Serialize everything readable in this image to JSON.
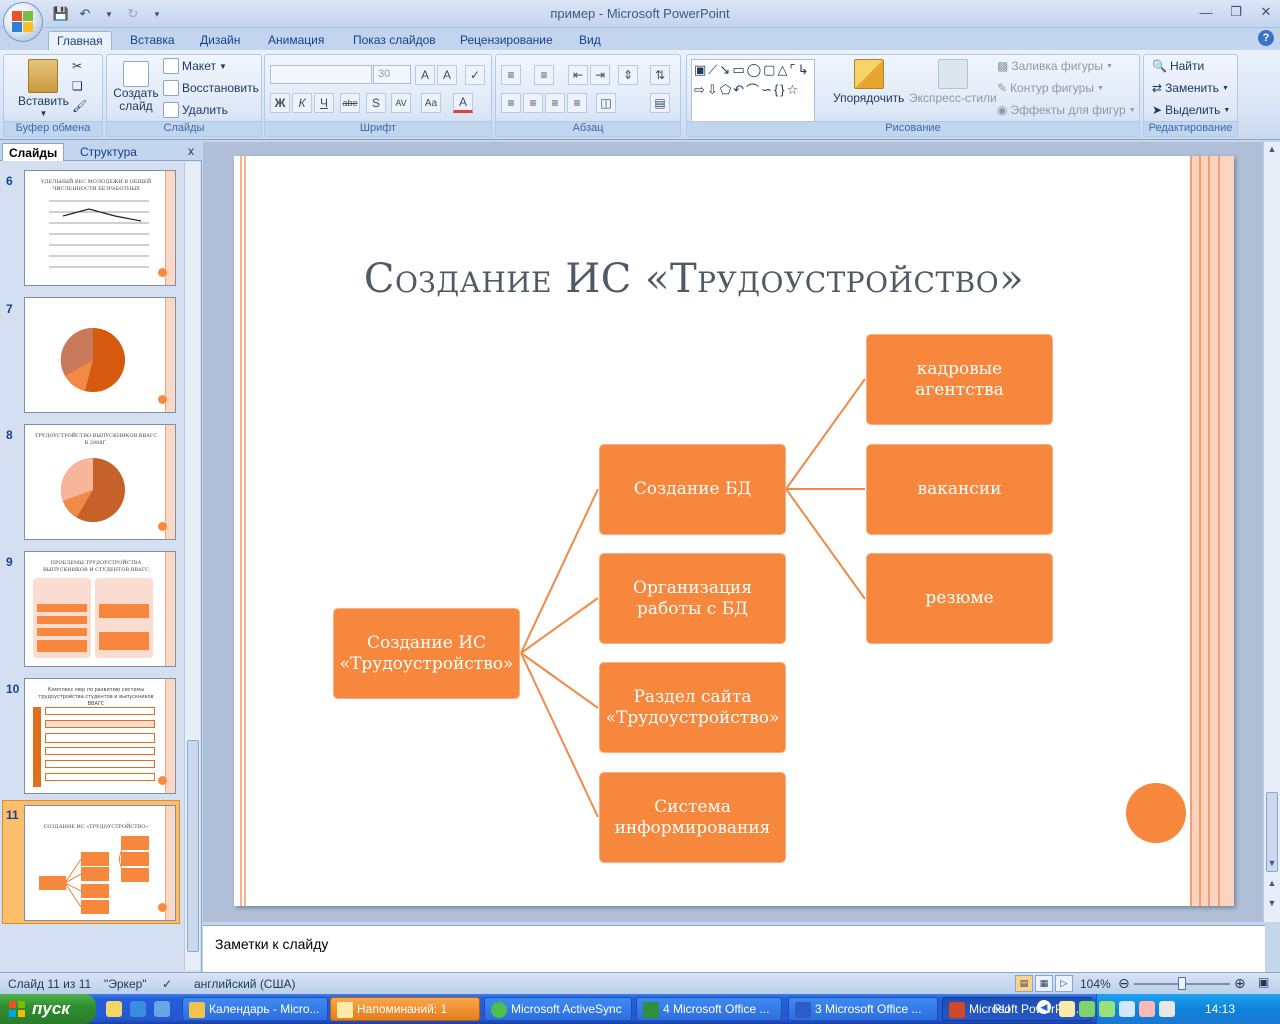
{
  "window": {
    "title": "пример - Microsoft PowerPoint"
  },
  "ribbon": {
    "tabs": [
      "Главная",
      "Вставка",
      "Дизайн",
      "Анимация",
      "Показ слайдов",
      "Рецензирование",
      "Вид"
    ],
    "groups": {
      "clipboard": {
        "label": "Буфер обмена",
        "paste": "Вставить"
      },
      "slides": {
        "label": "Слайды",
        "new_slide": "Создать слайд",
        "layout": "Макет",
        "reset": "Восстановить",
        "delete": "Удалить"
      },
      "font": {
        "label": "Шрифт",
        "font_size": "30"
      },
      "paragraph": {
        "label": "Абзац"
      },
      "drawing": {
        "label": "Рисование",
        "arrange": "Упорядочить",
        "quick_styles": "Экспресс-стили",
        "fill": "Заливка фигуры",
        "outline": "Контур фигуры",
        "effects": "Эффекты для фигур"
      },
      "editing": {
        "label": "Редактирование",
        "find": "Найти",
        "replace": "Заменить",
        "select": "Выделить"
      }
    }
  },
  "slide_pane": {
    "tabs": [
      "Слайды",
      "Структура"
    ],
    "close": "x",
    "thumbnails": [
      {
        "num": "6",
        "title": "УДЕЛЬНЫЙ ВЕС МОЛОДЕЖИ В ОБЩЕЙ ЧИСЛЕННОСТИ БЕЗРАБОТНЫХ"
      },
      {
        "num": "7",
        "title": ""
      },
      {
        "num": "8",
        "title": "ТРУДОУСТРОЙСТВО ВЫПУСКНИКОВ ВВАГС В 2008Г."
      },
      {
        "num": "9",
        "title": "ПРОБЛЕМЫ ТРУДОУСТРОЙСТВА ВЫПУСКНИКОВ И СТУДЕНТОВ ВВАГС"
      },
      {
        "num": "10",
        "title": "Комплекс мер по развитию системы трудоустройства студентов и выпускников ВВАГС"
      },
      {
        "num": "11",
        "title": "СОЗДАНИЕ ИС «ТРУДОУСТРОЙСТВО»"
      }
    ]
  },
  "slide": {
    "title": "Создание ИС «Трудоустройство»",
    "nodes": {
      "root": "Создание ИС «Трудоустройство»",
      "db": "Создание БД",
      "org": "Организация работы с БД",
      "site": "Раздел сайта «Трудоустройство»",
      "info": "Система информирования",
      "agencies": "кадровые агентства",
      "vacancies": "вакансии",
      "resume": "резюме"
    }
  },
  "notes": {
    "placeholder": "Заметки к слайду"
  },
  "status": {
    "slide_info": "Слайд 11 из 11",
    "theme": "\"Эркер\"",
    "language": "английский (США)",
    "zoom": "104%"
  },
  "taskbar": {
    "start": "пуск",
    "buttons": [
      "Календарь - Micro...",
      "Напоминаний: 1",
      "Microsoft ActiveSync",
      "4 Microsoft Office ...",
      "3 Microsoft Office ...",
      "Microsoft PowerPoi..."
    ],
    "lang": "RU",
    "clock": "14:13"
  }
}
